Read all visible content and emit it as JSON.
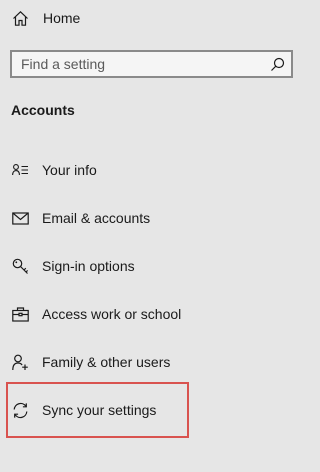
{
  "home": {
    "label": "Home",
    "icon": "home-icon"
  },
  "search": {
    "placeholder": "Find a setting",
    "value": "",
    "icon": "search-icon"
  },
  "section_title": "Accounts",
  "nav": {
    "items": [
      {
        "label": "Your info",
        "icon": "person-card-icon"
      },
      {
        "label": "Email & accounts",
        "icon": "mail-icon"
      },
      {
        "label": "Sign-in options",
        "icon": "key-icon"
      },
      {
        "label": "Access work or school",
        "icon": "briefcase-icon"
      },
      {
        "label": "Family & other users",
        "icon": "person-add-icon"
      },
      {
        "label": "Sync your settings",
        "icon": "sync-icon",
        "highlighted": true
      }
    ]
  },
  "colors": {
    "background": "#e6e6e6",
    "highlight": "#d9534f"
  }
}
